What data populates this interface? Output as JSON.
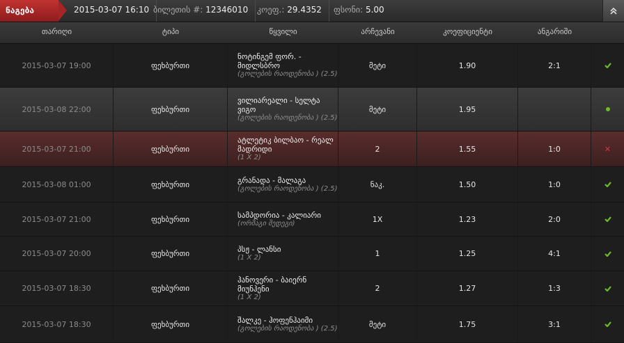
{
  "header": {
    "status_tab": "ნაგება",
    "datetime": "2015-03-07 16:10",
    "ticket_label": "ბილეთის #:",
    "ticket_value": "12346010",
    "coef_label": "კოეფ.:",
    "coef_value": "29.4352",
    "stake_label": "ფსონი:",
    "stake_value": "5.00",
    "collapse_icon": "double-chevron-up-icon"
  },
  "columns": {
    "date": "თარიღი",
    "type": "ტიპი",
    "event": "წყვილი",
    "pick": "არჩევანი",
    "odds": "კოეფიციენტი",
    "result": "ანგარიში"
  },
  "colors": {
    "won_row": "#3e4a34",
    "pending_row": "#3c3c3c",
    "lost_row": "#5a2c2c",
    "status_tab": "#c13232",
    "check": "#6cbb2c",
    "cross": "#d43b3b"
  },
  "rows": [
    {
      "date": "2015-03-07 19:00",
      "type": "ფეხბურთი",
      "event": "ნოტინგემ ფორ. - მიდლსბრო",
      "market": "(გოლების რაოდენობა ) (2.5)",
      "pick": "მეტი",
      "odds": "1.90",
      "result": "2:1",
      "status": "won"
    },
    {
      "date": "2015-03-08 22:00",
      "type": "ფეხბურთი",
      "event": "ვილიარეალი - სელტა ვიგო",
      "market": "(გოლების რაოდენობა ) (2.5)",
      "pick": "მეტი",
      "odds": "1.95",
      "result": "",
      "status": "pending"
    },
    {
      "date": "2015-03-07 21:00",
      "type": "ფეხბურთი",
      "event": "ატლეტიკ ბილბაო - რეალ მადრიდი",
      "market": "(1 X 2)",
      "pick": "2",
      "odds": "1.55",
      "result": "1:0",
      "status": "lost"
    },
    {
      "date": "2015-03-08 01:00",
      "type": "ფეხბურთი",
      "event": "გრანადა - მალაგა",
      "market": "(გოლების რაოდენობა ) (2.5)",
      "pick": "ნაკ.",
      "odds": "1.50",
      "result": "1:0",
      "status": "won"
    },
    {
      "date": "2015-03-07 21:00",
      "type": "ფეხბურთი",
      "event": "სამპდორია - კალიარი",
      "market": "(ორმაგი შედეგი)",
      "pick": "1X",
      "odds": "1.23",
      "result": "2:0",
      "status": "won"
    },
    {
      "date": "2015-03-07 20:00",
      "type": "ფეხბურთი",
      "event": "პსჟ - ლანსი",
      "market": "(1 X 2)",
      "pick": "1",
      "odds": "1.25",
      "result": "4:1",
      "status": "won"
    },
    {
      "date": "2015-03-07 18:30",
      "type": "ფეხბურთი",
      "event": "ჰანოვერი - ბაიერნ მიუნჰენი",
      "market": "(1 X 2)",
      "pick": "2",
      "odds": "1.27",
      "result": "1:3",
      "status": "won"
    },
    {
      "date": "2015-03-07 18:30",
      "type": "ფეხბურთი",
      "event": "შალკე - ჰოფენჰაიმი",
      "market": "(გოლების რაოდენობა ) (2.5)",
      "pick": "მეტი",
      "odds": "1.75",
      "result": "3:1",
      "status": "won"
    }
  ]
}
